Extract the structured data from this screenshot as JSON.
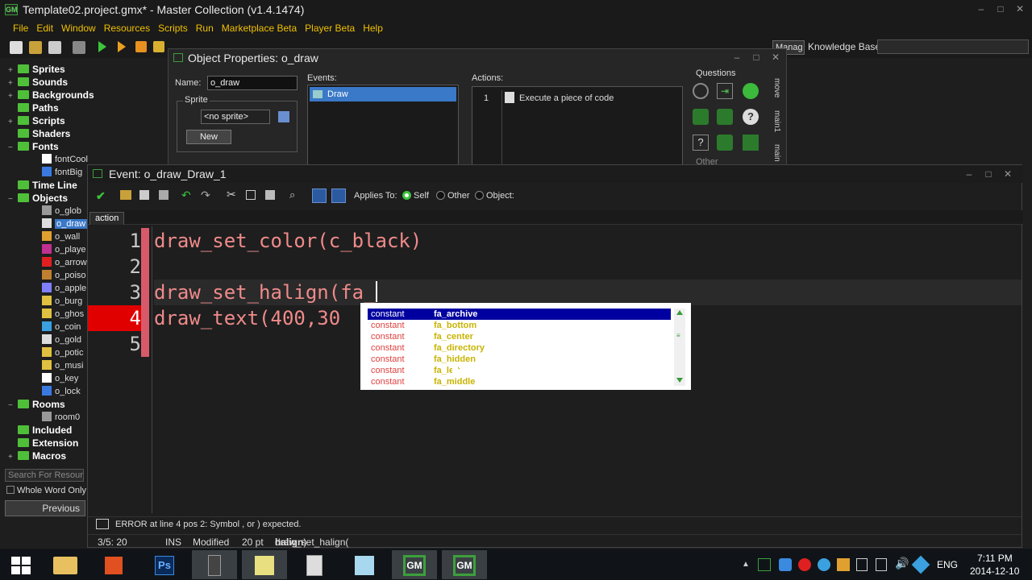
{
  "window": {
    "title": "Template02.project.gmx*  -  Master Collection (v1.4.1474)",
    "app_icon": "gm"
  },
  "menu": [
    "File",
    "Edit",
    "Window",
    "Resources",
    "Scripts",
    "Run",
    "Marketplace Beta",
    "Player Beta",
    "Help"
  ],
  "toolbar": {
    "manage_label": "Manag",
    "knowledge_base_label": "Knowledge Base:"
  },
  "tree": {
    "items": [
      {
        "label": "Sprites",
        "type": "folder",
        "level": 0,
        "expander": "+"
      },
      {
        "label": "Sounds",
        "type": "folder",
        "level": 0,
        "expander": "+"
      },
      {
        "label": "Backgrounds",
        "type": "folder",
        "level": 0,
        "expander": "+"
      },
      {
        "label": "Paths",
        "type": "folder",
        "level": 0,
        "expander": ""
      },
      {
        "label": "Scripts",
        "type": "folder",
        "level": 0,
        "expander": "+"
      },
      {
        "label": "Shaders",
        "type": "folder",
        "level": 0,
        "expander": ""
      },
      {
        "label": "Fonts",
        "type": "folder",
        "level": 0,
        "expander": "−"
      },
      {
        "label": "fontCool",
        "type": "child",
        "level": 1,
        "expander": ""
      },
      {
        "label": "fontBig",
        "type": "child",
        "level": 1,
        "expander": ""
      },
      {
        "label": "Time Line",
        "type": "folder",
        "level": 0,
        "expander": ""
      },
      {
        "label": "Objects",
        "type": "folder",
        "level": 0,
        "expander": "−"
      },
      {
        "label": "o_glob",
        "type": "child",
        "level": 1,
        "expander": ""
      },
      {
        "label": "o_draw",
        "type": "child",
        "level": 1,
        "expander": "",
        "selected": true
      },
      {
        "label": "o_wall",
        "type": "child",
        "level": 1,
        "expander": ""
      },
      {
        "label": "o_playe",
        "type": "child",
        "level": 1,
        "expander": ""
      },
      {
        "label": "o_arrow",
        "type": "child",
        "level": 1,
        "expander": ""
      },
      {
        "label": "o_poiso",
        "type": "child",
        "level": 1,
        "expander": ""
      },
      {
        "label": "o_apple",
        "type": "child",
        "level": 1,
        "expander": ""
      },
      {
        "label": "o_burg",
        "type": "child",
        "level": 1,
        "expander": ""
      },
      {
        "label": "o_ghos",
        "type": "child",
        "level": 1,
        "expander": ""
      },
      {
        "label": "o_coin",
        "type": "child",
        "level": 1,
        "expander": ""
      },
      {
        "label": "o_gold",
        "type": "child",
        "level": 1,
        "expander": ""
      },
      {
        "label": "o_potic",
        "type": "child",
        "level": 1,
        "expander": ""
      },
      {
        "label": "o_musi",
        "type": "child",
        "level": 1,
        "expander": ""
      },
      {
        "label": "o_key",
        "type": "child",
        "level": 1,
        "expander": ""
      },
      {
        "label": "o_lock",
        "type": "child",
        "level": 1,
        "expander": ""
      },
      {
        "label": "Rooms",
        "type": "folder",
        "level": 0,
        "expander": "−"
      },
      {
        "label": "room0",
        "type": "child",
        "level": 1,
        "expander": ""
      },
      {
        "label": "Included",
        "type": "folder",
        "level": 0,
        "expander": ""
      },
      {
        "label": "Extension",
        "type": "folder",
        "level": 0,
        "expander": ""
      },
      {
        "label": "Macros",
        "type": "folder",
        "level": 0,
        "expander": "+"
      }
    ],
    "search_placeholder": "Search For Resource",
    "whole_word_label": "Whole Word Only",
    "previous_label": "Previous"
  },
  "object_properties": {
    "title": "Object Properties: o_draw",
    "name_label": "Name:",
    "name_value": "o_draw",
    "sprite_group": "Sprite",
    "sprite_value": "<no sprite>",
    "new_label": "New",
    "events_label": "Events:",
    "events": [
      "Draw"
    ],
    "actions_label": "Actions:",
    "actions": [
      {
        "index": "1",
        "label": "Execute a piece of code"
      }
    ],
    "questions_label": "Questions",
    "other_label": "Other",
    "side_tabs": [
      "move",
      "main1",
      "main"
    ]
  },
  "event_window": {
    "title": "Event: o_draw_Draw_1",
    "applies_to_label": "Applies To:",
    "applies_options": [
      "Self",
      "Other",
      "Object:"
    ],
    "applies_selected": "Self",
    "tab": "action",
    "code_lines": [
      {
        "num": "1",
        "text": "draw_set_color(c_black)",
        "error": false
      },
      {
        "num": "2",
        "text": "",
        "error": false
      },
      {
        "num": "3",
        "text": "draw_set_halign(fa_",
        "error": false,
        "current": true
      },
      {
        "num": "4",
        "text": "draw_text(400,30",
        "error": true
      },
      {
        "num": "5",
        "text": "",
        "error": false
      }
    ],
    "autocomplete": [
      {
        "kind": "constant",
        "name": "fa_archive"
      },
      {
        "kind": "constant",
        "name": "fa_bottom"
      },
      {
        "kind": "constant",
        "name": "fa_center"
      },
      {
        "kind": "constant",
        "name": "fa_directory"
      },
      {
        "kind": "constant",
        "name": "fa_hidden"
      },
      {
        "kind": "constant",
        "name": "fa_left"
      },
      {
        "kind": "constant",
        "name": "fa_middle"
      }
    ],
    "error_message": "ERROR at line 4 pos 2: Symbol , or ) expected.",
    "status": {
      "position": "3/5:  20",
      "mode": "INS",
      "modified": "Modified",
      "font_size": "20 pt",
      "hint_prefix": "draw_set_halign(",
      "hint_arg": "halign",
      "hint_suffix": ")"
    }
  },
  "taskbar": {
    "language": "ENG",
    "time": "7:11 PM",
    "date": "2014-12-10",
    "ps_label": "Ps"
  },
  "colors": {
    "menu_text": "#f0c000",
    "folder": "#4fbf3a",
    "selection": "#3a78c8",
    "error_line": "#e00000",
    "code_text": "#f08a8a"
  }
}
